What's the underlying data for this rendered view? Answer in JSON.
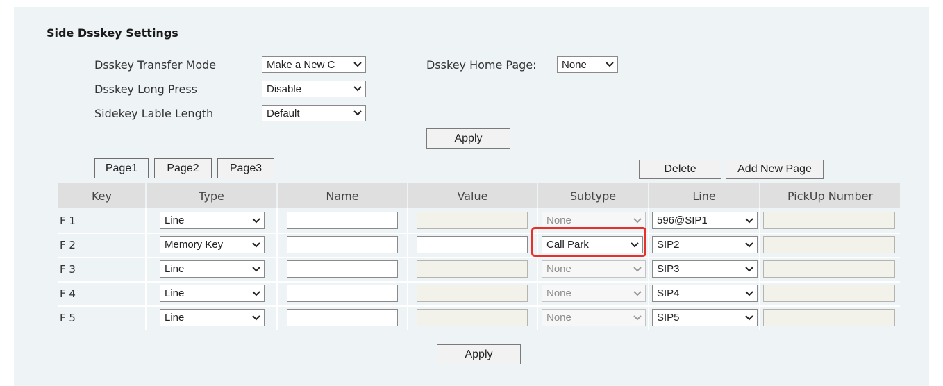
{
  "section_title": "Side Dsskey Settings",
  "settings": {
    "transfer_mode_label": "Dsskey Transfer Mode",
    "transfer_mode_value": "Make a New C",
    "long_press_label": "Dsskey Long Press",
    "long_press_value": "Disable",
    "lable_length_label": "Sidekey Lable Length",
    "lable_length_value": "Default",
    "home_page_label": "Dsskey Home Page:",
    "home_page_value": "None",
    "apply_label": "Apply"
  },
  "tabs": [
    "Page1",
    "Page2",
    "Page3"
  ],
  "actions": {
    "delete_label": "Delete",
    "add_page_label": "Add New Page"
  },
  "table": {
    "headers": [
      "Key",
      "Type",
      "Name",
      "Value",
      "Subtype",
      "Line",
      "PickUp Number"
    ],
    "rows": [
      {
        "key": "F 1",
        "type": "Line",
        "name": "",
        "value": "",
        "subtype": "None",
        "line": "596@SIP1",
        "pickup": ""
      },
      {
        "key": "F 2",
        "type": "Memory Key",
        "name": "",
        "value": "",
        "subtype": "Call Park",
        "line": "SIP2",
        "pickup": ""
      },
      {
        "key": "F 3",
        "type": "Line",
        "name": "",
        "value": "",
        "subtype": "None",
        "line": "SIP3",
        "pickup": ""
      },
      {
        "key": "F 4",
        "type": "Line",
        "name": "",
        "value": "",
        "subtype": "None",
        "line": "SIP4",
        "pickup": ""
      },
      {
        "key": "F 5",
        "type": "Line",
        "name": "",
        "value": "",
        "subtype": "None",
        "line": "SIP5",
        "pickup": ""
      }
    ]
  },
  "footer_apply_label": "Apply",
  "colors": {
    "panel": "#eef3f6",
    "header": "#dfdfdf",
    "highlight": "#e8302a",
    "readonly_field": "#f2f2ea"
  }
}
